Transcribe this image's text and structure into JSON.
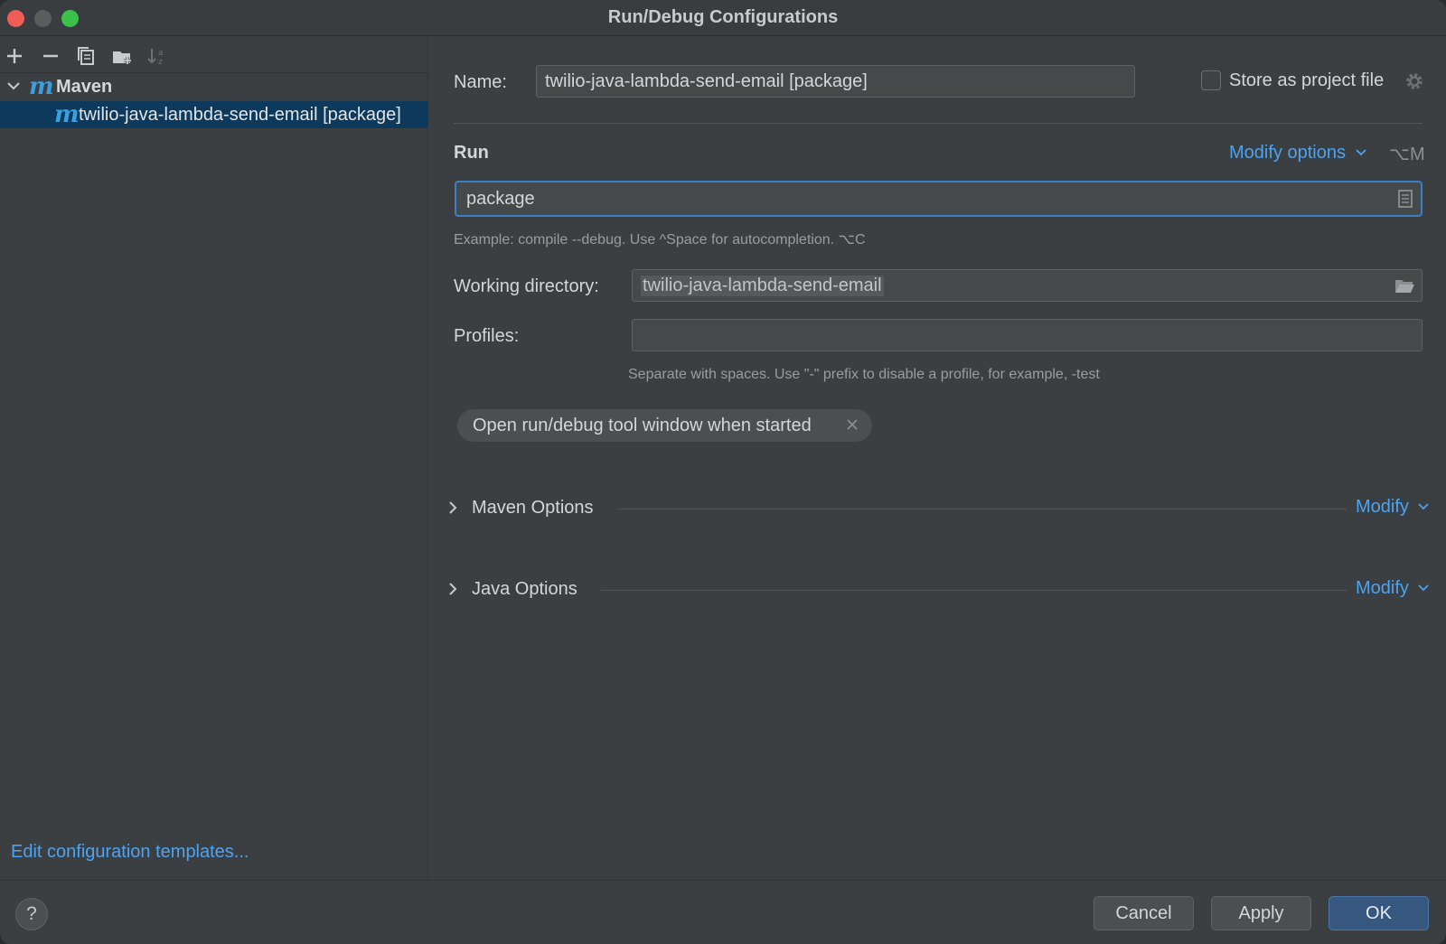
{
  "window": {
    "title": "Run/Debug Configurations"
  },
  "left_panel": {
    "toolbar_icons": [
      "add-icon",
      "remove-icon",
      "copy-icon",
      "folder-add-icon",
      "sort-icon"
    ],
    "tree": {
      "group_label": "Maven",
      "item_label": "twilio-java-lambda-send-email [package]"
    },
    "edit_templates_link": "Edit configuration templates..."
  },
  "config": {
    "name_label": "Name:",
    "name_value": "twilio-java-lambda-send-email [package]",
    "store_label": "Store as project file",
    "store_checked": false,
    "run_section": "Run",
    "modify_options_label": "Modify options",
    "modify_options_shortcut": "⌥M",
    "command_value": "package",
    "command_hint": "Example: compile --debug. Use ^Space for autocompletion. ⌥C",
    "working_dir_label": "Working directory:",
    "working_dir_value": "twilio-java-lambda-send-email",
    "profiles_label": "Profiles:",
    "profiles_value": "",
    "profiles_hint": "Separate with spaces. Use \"-\" prefix to disable a profile, for example, -test",
    "chip_label": "Open run/debug tool window when started",
    "sections": [
      {
        "label": "Maven Options",
        "modify": "Modify"
      },
      {
        "label": "Java Options",
        "modify": "Modify"
      }
    ]
  },
  "footer": {
    "help_label": "?",
    "cancel_label": "Cancel",
    "apply_label": "Apply",
    "ok_label": "OK"
  },
  "colors": {
    "accent": "#4da3f0",
    "selection": "#0d3a5c",
    "focus_border": "#3d7fc6",
    "primary_button": "#365880"
  }
}
